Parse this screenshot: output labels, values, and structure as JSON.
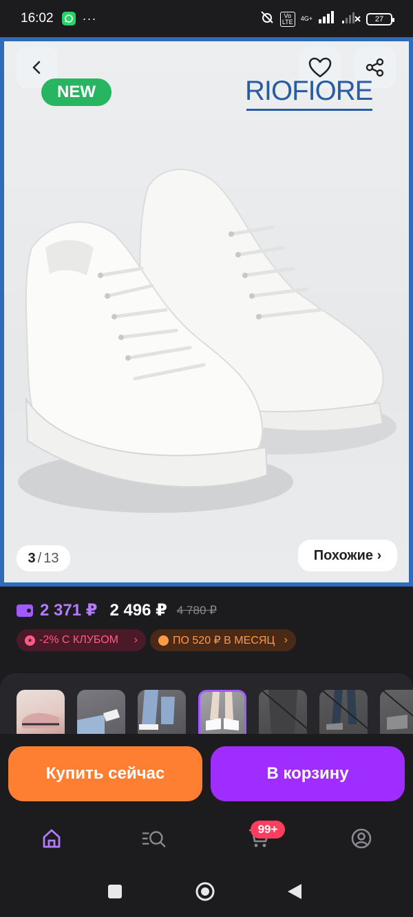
{
  "status_bar": {
    "time": "16:02",
    "dots": "···",
    "network": "4G+",
    "volte": "Vo LTE",
    "battery": "27"
  },
  "product_image": {
    "badge": "NEW",
    "brand": "RIOFIORE",
    "counter_current": "3",
    "counter_sep": "/",
    "counter_total": "13",
    "similar_label": "Похожие ›"
  },
  "prices": {
    "club_price": "2 371 ₽",
    "price": "2 496 ₽",
    "old_price": "4 780 ₽"
  },
  "tags": {
    "club": "-2% С КЛУБОМ",
    "installment": "ПО 520 ₽ В МЕСЯЦ",
    "chevron": "›"
  },
  "actions": {
    "buy_now": "Купить сейчас",
    "add_to_cart": "В корзину"
  },
  "tabbar": {
    "cart_badge": "99+"
  },
  "colors": {
    "accent_purple": "#a02dff",
    "accent_orange": "#ff7f32",
    "new_green": "#27b562",
    "badge_red": "#ff3d5e"
  }
}
